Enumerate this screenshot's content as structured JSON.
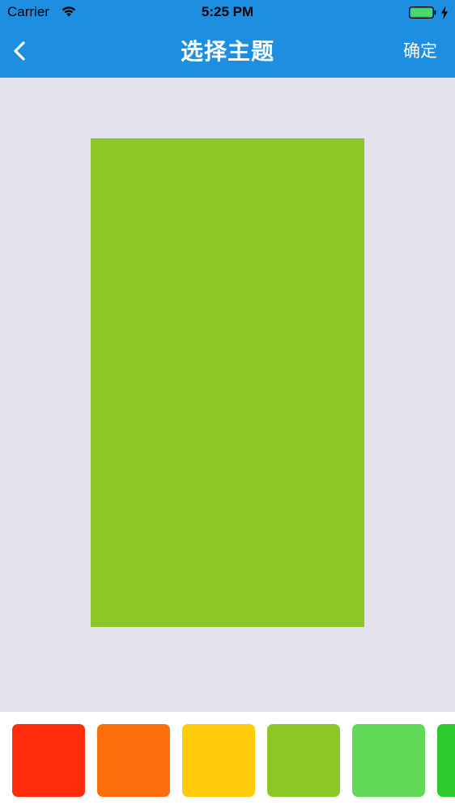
{
  "status_bar": {
    "carrier": "Carrier",
    "time": "5:25 PM",
    "battery_color": "#4cd964"
  },
  "nav": {
    "title": "选择主题",
    "confirm": "确定",
    "background": "#1d8ee0",
    "back_icon": "chevron-left-icon"
  },
  "preview": {
    "color": "#8cc728"
  },
  "palette": {
    "swatches": [
      {
        "color": "#ff2d0c"
      },
      {
        "color": "#ff6e0c"
      },
      {
        "color": "#ffcc0a"
      },
      {
        "color": "#8cc728"
      },
      {
        "color": "#63d95a"
      },
      {
        "color": "#2ec92a"
      }
    ]
  }
}
